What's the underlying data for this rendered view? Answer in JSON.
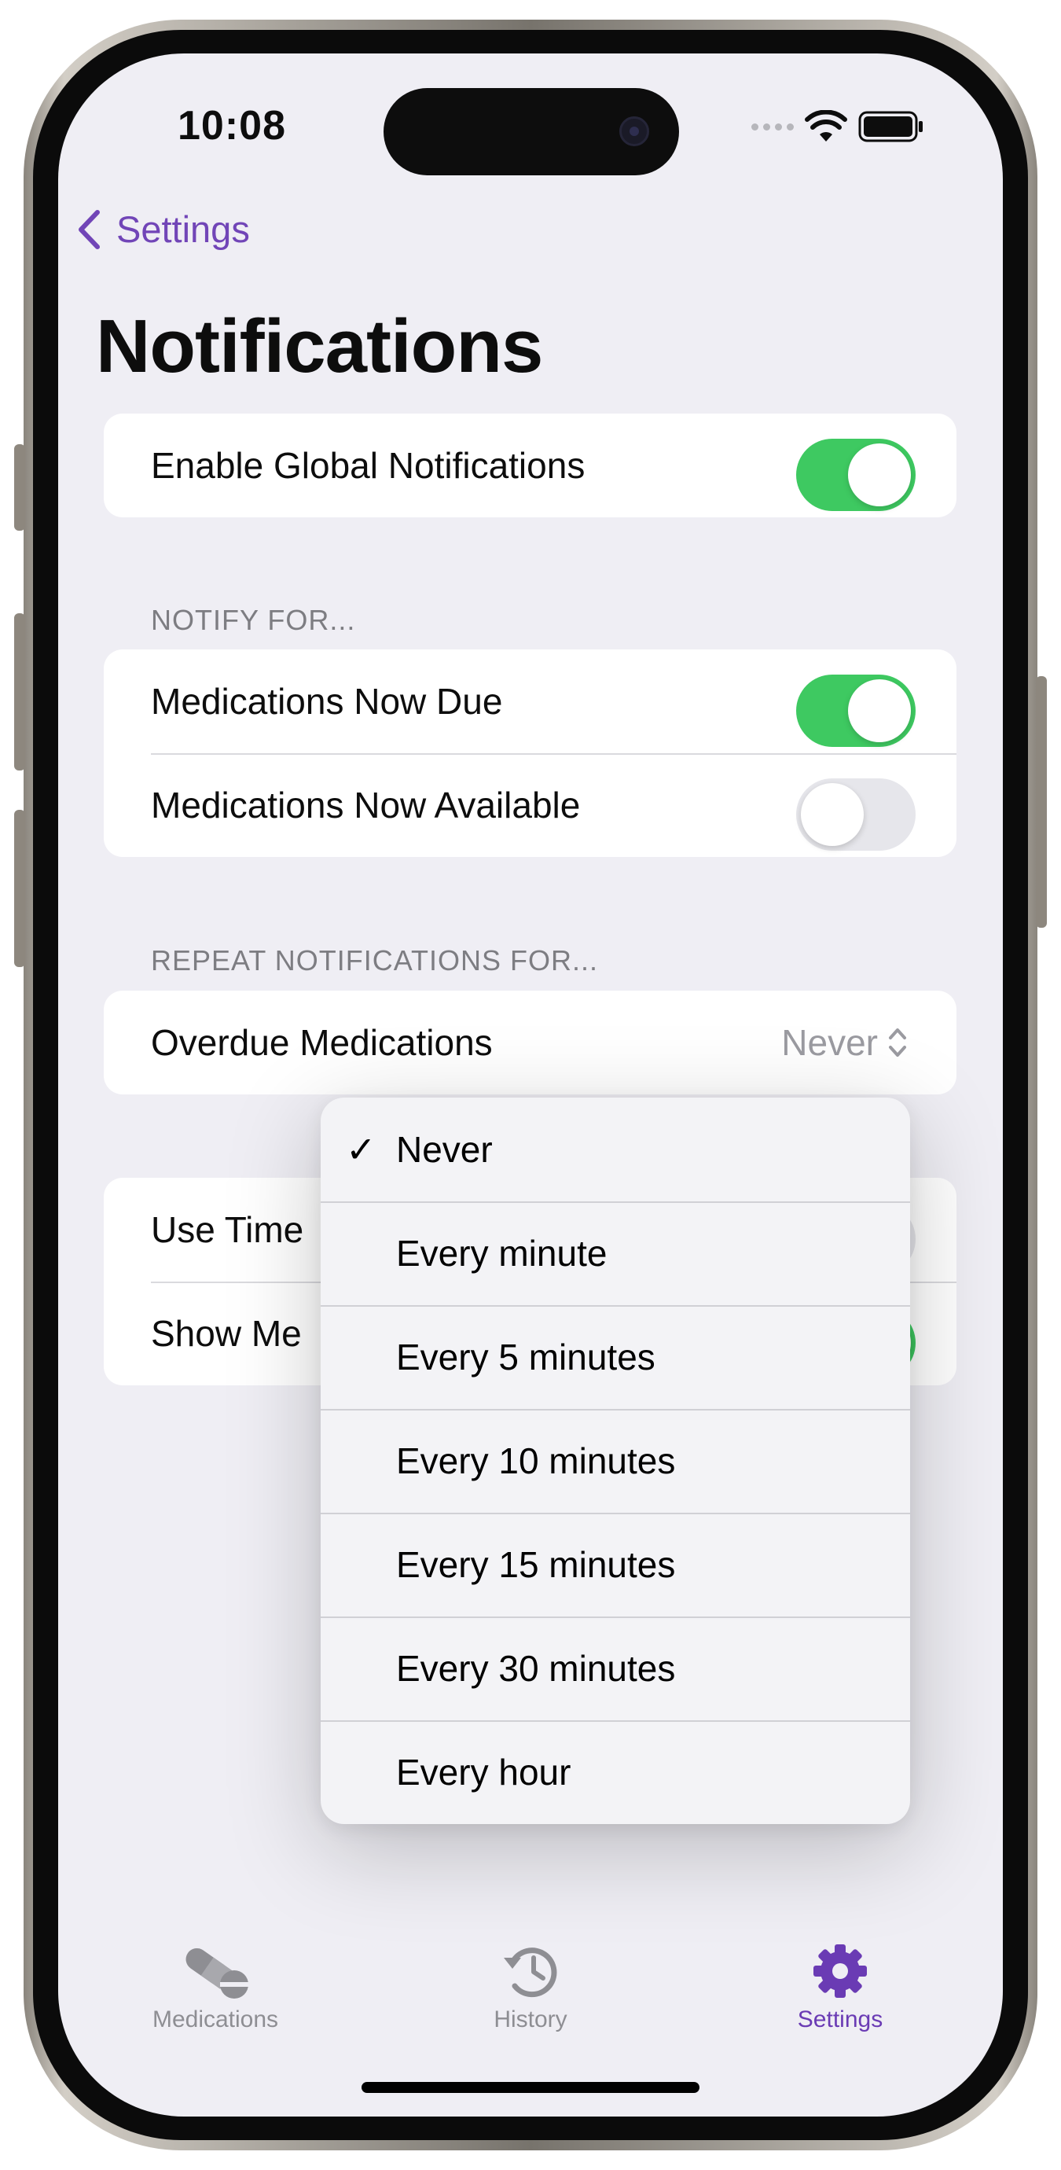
{
  "status_bar": {
    "time": "10:08"
  },
  "nav": {
    "back_label": "Settings"
  },
  "title": "Notifications",
  "global": {
    "label": "Enable Global Notifications",
    "on": true
  },
  "notify_for": {
    "header": "NOTIFY FOR...",
    "items": [
      {
        "label": "Medications Now Due",
        "on": true
      },
      {
        "label": "Medications Now Available",
        "on": false
      }
    ]
  },
  "repeat": {
    "header": "REPEAT NOTIFICATIONS FOR...",
    "overdue_label": "Overdue Medications",
    "overdue_value": "Never"
  },
  "other": {
    "items": [
      {
        "label": "Use Time"
      },
      {
        "label": "Show Me"
      }
    ]
  },
  "dropdown": {
    "selected": "Never",
    "check_glyph": "✓",
    "options": [
      "Never",
      "Every minute",
      "Every 5 minutes",
      "Every 10 minutes",
      "Every 15 minutes",
      "Every 30 minutes",
      "Every hour"
    ]
  },
  "tabs": [
    {
      "label": "Medications",
      "icon": "pills-icon",
      "active": false
    },
    {
      "label": "History",
      "icon": "history-icon",
      "active": false
    },
    {
      "label": "Settings",
      "icon": "gear-icon",
      "active": true
    }
  ],
  "colors": {
    "accent": "#6a3bb4",
    "toggle_on": "#34c759",
    "toggle_off": "#e5e5ea",
    "background": "#efeef4"
  }
}
